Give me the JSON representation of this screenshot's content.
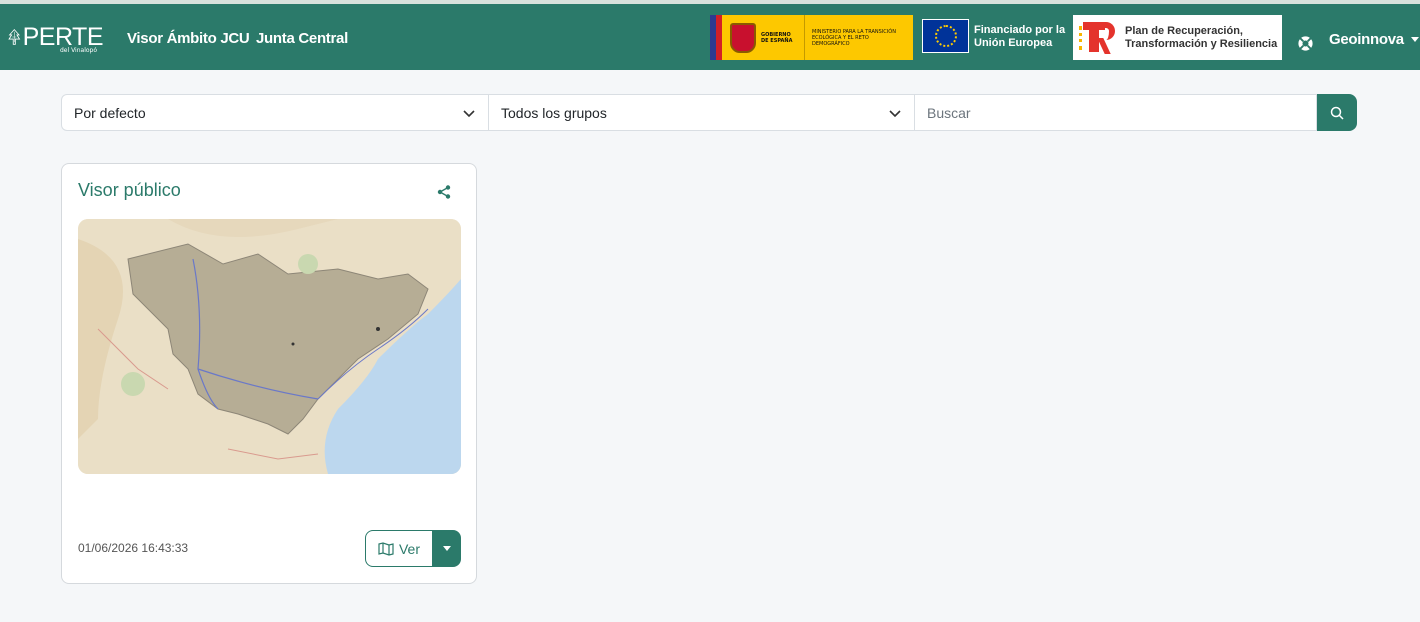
{
  "header": {
    "brand": "PERTE",
    "brand_sub": "del Vinalopó",
    "nav": [
      {
        "label": "Visor Ámbito JCU"
      },
      {
        "label": "Junta Central"
      }
    ],
    "logos": {
      "gobierno_line1": "GOBIERNO DE ESPAÑA",
      "gobierno_line2": "MINISTERIO PARA LA TRANSICIÓN ECOLÓGICA Y EL RETO DEMOGRÁFICO",
      "eu_text": "Financiado por la Unión Europea",
      "prtr_text": "Plan de Recuperación, Transformación y Resiliencia"
    },
    "user": "Geoinnova",
    "help_icon": "lifebuoy-icon",
    "colors": {
      "primary": "#2b7a6a"
    }
  },
  "filters": {
    "sort": {
      "selected": "Por defecto"
    },
    "group": {
      "selected": "Todos los grupos"
    },
    "search": {
      "placeholder": "Buscar"
    }
  },
  "cards": [
    {
      "title": "Visor público",
      "date": "01/06/2026 16:43:33",
      "view_label": "Ver"
    }
  ]
}
